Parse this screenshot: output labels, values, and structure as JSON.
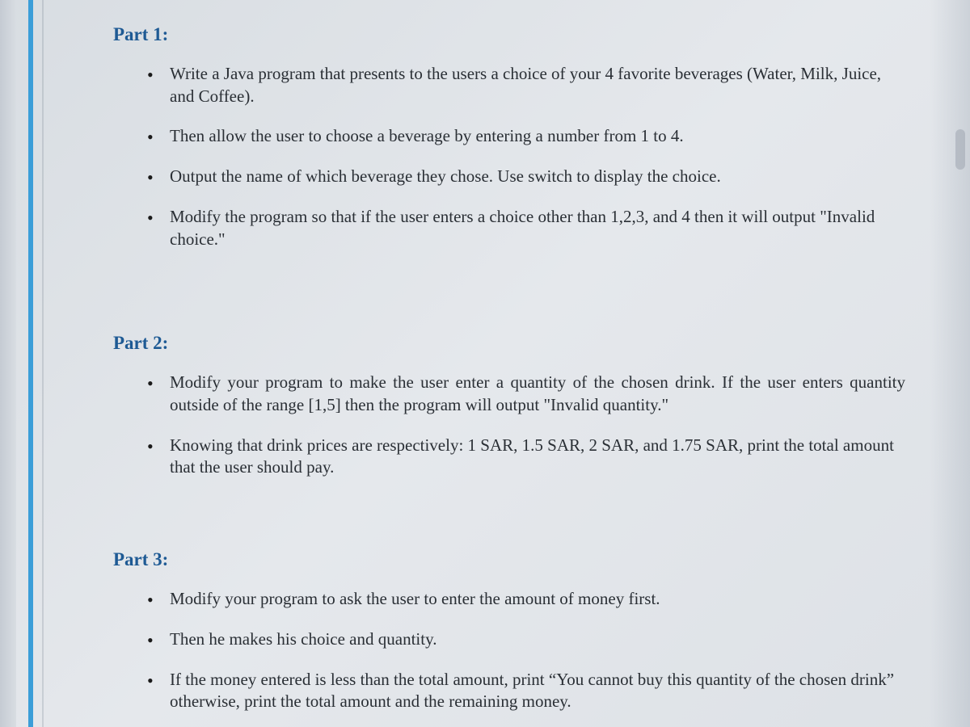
{
  "parts": [
    {
      "heading": "Part 1:",
      "items": [
        "Write a Java program that presents to the users a choice of your 4 favorite beverages (Water, Milk, Juice, and Coffee).",
        "Then allow the user to choose a beverage by entering a number from 1 to 4.",
        "Output the name of which beverage they chose. Use switch to display the choice.",
        "Modify the program so that if the user enters a choice other than 1,2,3, and 4 then it will output \"Invalid choice.\""
      ]
    },
    {
      "heading": "Part 2:",
      "items": [
        "Modify your program to make the user enter a quantity of the chosen drink. If the user enters quantity outside of the range [1,5] then the program will output \"Invalid quantity.\"",
        "Knowing that drink prices are respectively: 1 SAR, 1.5 SAR, 2 SAR, and 1.75 SAR, print the total amount that the user should pay."
      ]
    },
    {
      "heading": "Part 3:",
      "items": [
        "Modify your program to ask the user to enter the amount of money first.",
        "Then he makes his choice and quantity.",
        "If the money entered is less than the total amount, print “You cannot buy this quantity of the chosen drink” otherwise, print the total amount and the remaining money."
      ]
    }
  ]
}
